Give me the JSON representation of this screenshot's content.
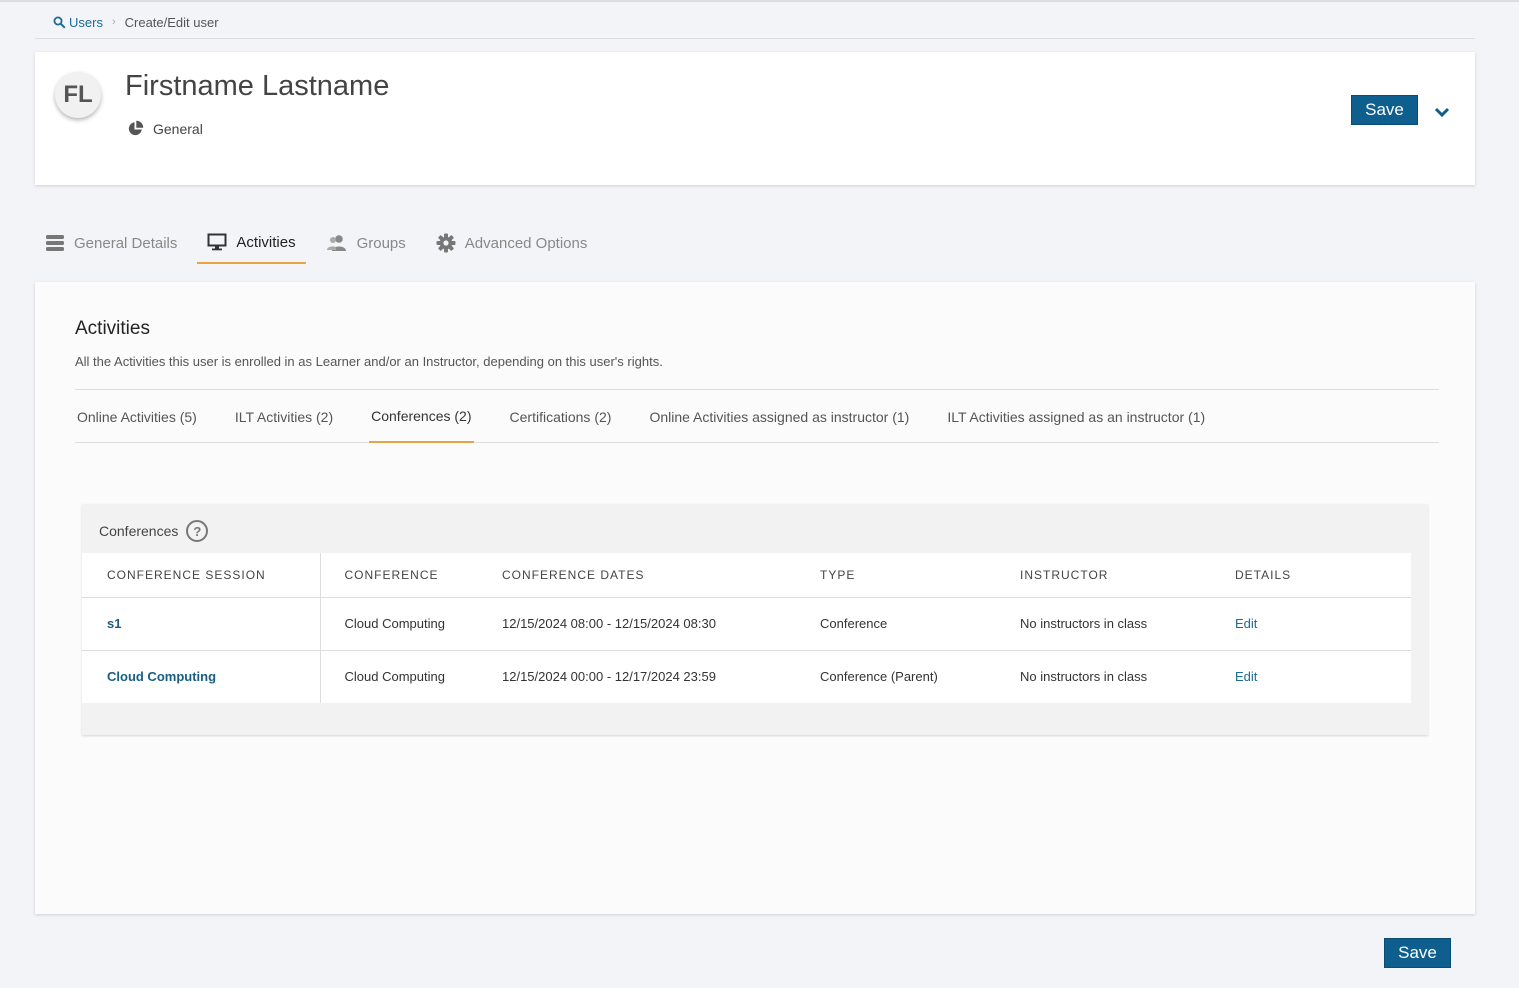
{
  "breadcrumb": {
    "users_label": "Users",
    "current": "Create/Edit user"
  },
  "header": {
    "avatar_initials": "FL",
    "name": "Firstname Lastname",
    "user_type": "General",
    "save_label": "Save"
  },
  "main_tabs": [
    {
      "label": "General Details",
      "icon": "list-icon"
    },
    {
      "label": "Activities",
      "icon": "monitor-icon",
      "active": true
    },
    {
      "label": "Groups",
      "icon": "users-icon"
    },
    {
      "label": "Advanced Options",
      "icon": "gear-icon"
    }
  ],
  "activities": {
    "title": "Activities",
    "description": "All the Activities this user is enrolled in as Learner and/or an Instructor, depending on this user's rights.",
    "subtabs": [
      {
        "label": "Online Activities (5)"
      },
      {
        "label": "ILT Activities (2)"
      },
      {
        "label": "Conferences (2)",
        "active": true
      },
      {
        "label": "Certifications (2)"
      },
      {
        "label": "Online Activities assigned as instructor (1)"
      },
      {
        "label": "ILT Activities assigned as an instructor (1)"
      }
    ]
  },
  "conferences": {
    "panel_title": "Conferences",
    "help_glyph": "?",
    "columns": [
      "CONFERENCE SESSION",
      "CONFERENCE",
      "CONFERENCE DATES",
      "TYPE",
      "INSTRUCTOR",
      "DETAILS"
    ],
    "rows": [
      {
        "session": "s1",
        "conference": "Cloud Computing",
        "dates": "12/15/2024 08:00 - 12/15/2024 08:30",
        "type": "Conference",
        "instructor": "No instructors in class",
        "details": "Edit"
      },
      {
        "session": "Cloud Computing",
        "conference": "Cloud Computing",
        "dates": "12/15/2024 00:00 - 12/17/2024 23:59",
        "type": "Conference (Parent)",
        "instructor": "No instructors in class",
        "details": "Edit"
      }
    ]
  },
  "footer": {
    "save_label": "Save"
  },
  "colors": {
    "accent_underline": "#e8a541",
    "primary_button": "#0f5f8e",
    "link": "#1a6b96"
  }
}
